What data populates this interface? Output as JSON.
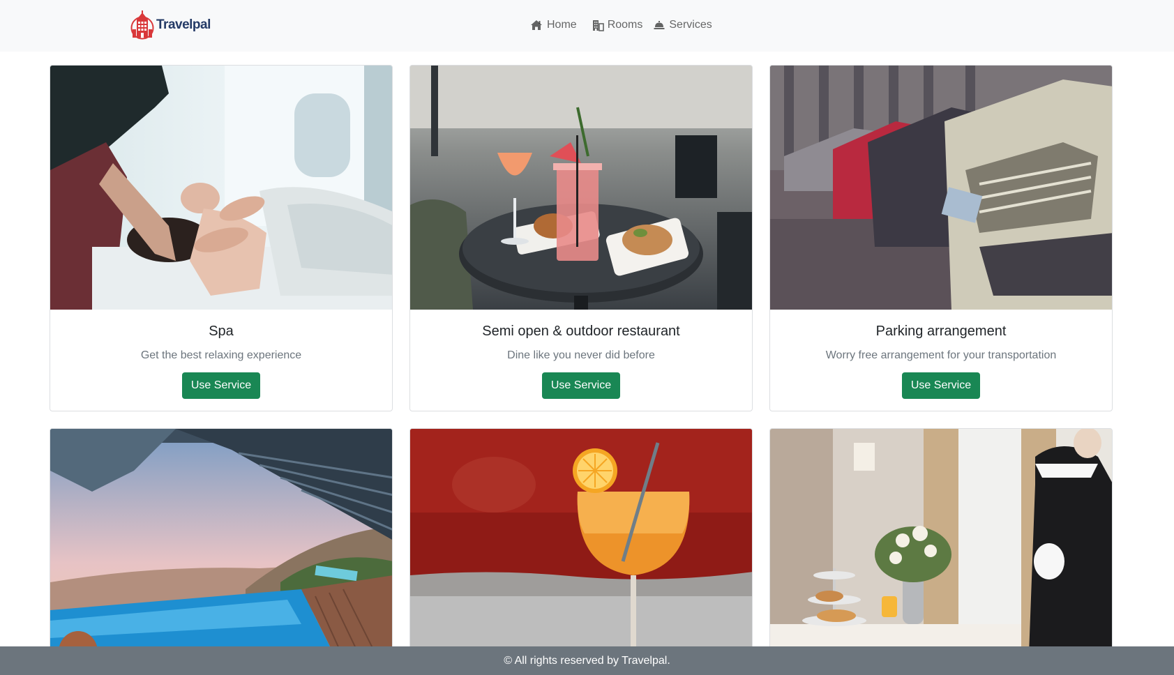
{
  "brand": {
    "name": "Travelpal"
  },
  "nav": {
    "items": [
      {
        "label": "Home",
        "icon": "home-icon"
      },
      {
        "label": "Rooms",
        "icon": "building-icon"
      },
      {
        "label": "Services",
        "icon": "service-bell-icon"
      }
    ]
  },
  "services": [
    {
      "title": "Spa",
      "description": "Get the best relaxing experience",
      "button": "Use Service",
      "image": "spa-massage-photo"
    },
    {
      "title": "Semi open & outdoor restaurant",
      "description": "Dine like you never did before",
      "button": "Use Service",
      "image": "outdoor-restaurant-photo"
    },
    {
      "title": "Parking arrangement",
      "description": "Worry free arrangement for your transportation",
      "button": "Use Service",
      "image": "parked-cars-photo"
    },
    {
      "title": "",
      "description": "",
      "button": "",
      "image": "infinity-pool-photo"
    },
    {
      "title": "",
      "description": "",
      "button": "",
      "image": "cocktail-drink-photo"
    },
    {
      "title": "",
      "description": "",
      "button": "",
      "image": "room-service-photo"
    }
  ],
  "footer": {
    "text": "© All rights reserved by Travelpal."
  },
  "colors": {
    "navbar_bg": "#f8f9fa",
    "button_green": "#198754",
    "footer_bg": "#6c757d",
    "brand_red": "#d9383a",
    "brand_navy": "#243a66"
  }
}
